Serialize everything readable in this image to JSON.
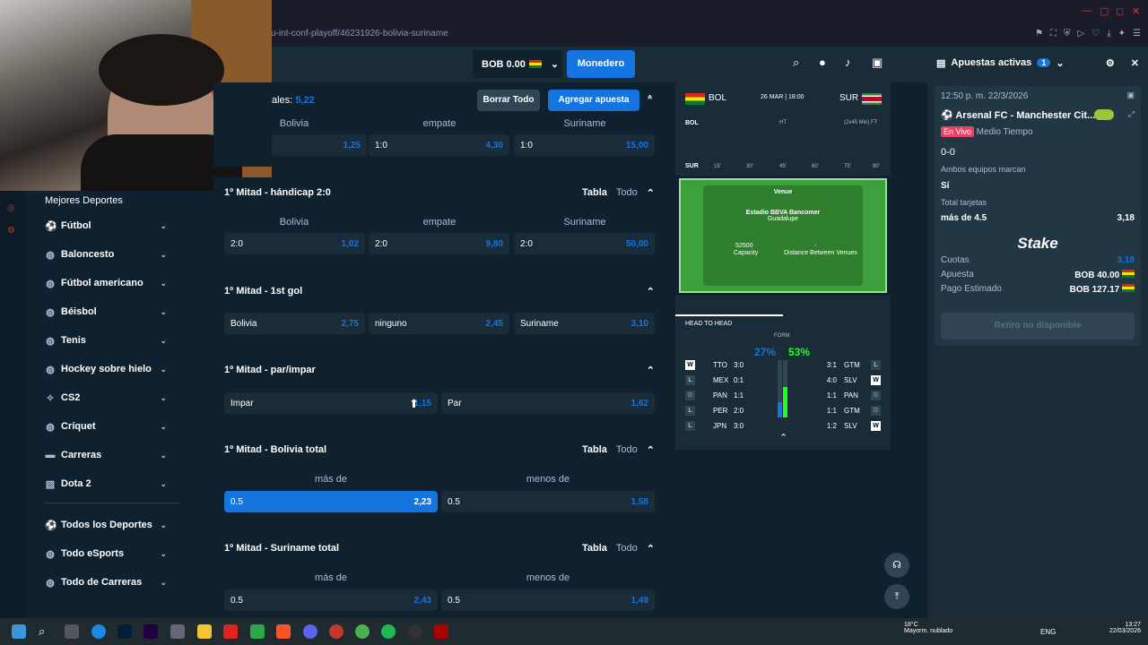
{
  "browser": {
    "url": "u-int-conf-playoff/46231926-bolivia-suriname"
  },
  "header": {
    "balance": "BOB 0.00",
    "wallet_label": "Monedero"
  },
  "sidebar": {
    "title": "Mejores Deportes",
    "items": [
      "Fútbol",
      "Baloncesto",
      "Fútbol americano",
      "Béisbol",
      "Tenis",
      "Hockey sobre hielo",
      "CS2",
      "Críquet",
      "Carreras",
      "Dota 2"
    ],
    "more": [
      "Todos los Deportes",
      "Todo eSports",
      "Todo de Carreras"
    ]
  },
  "toolbar": {
    "partial_label": "ales:",
    "partial_value": "5,22",
    "clear": "Borrar Todo",
    "add": "Agregar apuesta"
  },
  "common": {
    "tabla": "Tabla",
    "todo": "Todo",
    "mas": "más de",
    "menos": "menos de"
  },
  "sec0": {
    "cols": [
      "Bolivia",
      "empate",
      "Suriname"
    ],
    "odds": [
      {
        "l": "",
        "v": "1,25"
      },
      {
        "l": "1:0",
        "v": "4,30"
      },
      {
        "l": "1:0",
        "v": "15,00"
      }
    ]
  },
  "sec1": {
    "title": "1º Mitad - hándicap 2:0",
    "cols": [
      "Bolivia",
      "empate",
      "Suriname"
    ],
    "odds": [
      {
        "l": "2:0",
        "v": "1,02"
      },
      {
        "l": "2:0",
        "v": "9,80"
      },
      {
        "l": "2:0",
        "v": "50,00"
      }
    ]
  },
  "sec2": {
    "title": "1º Mitad - 1st gol",
    "odds": [
      {
        "l": "Bolivia",
        "v": "2,75"
      },
      {
        "l": "ninguno",
        "v": "2,45"
      },
      {
        "l": "Suriname",
        "v": "3,10"
      }
    ]
  },
  "sec3": {
    "title": "1º Mitad - par/impar",
    "odds": [
      {
        "l": "Impar",
        "v": "1,15"
      },
      {
        "l": "Par",
        "v": "1,62"
      }
    ]
  },
  "sec4": {
    "title": "1º Mitad - Bolivia total",
    "odds": [
      {
        "l": "0.5",
        "v": "2,23"
      },
      {
        "l": "0.5",
        "v": "1,58"
      }
    ]
  },
  "sec5": {
    "title": "1º Mitad - Suriname total",
    "odds": [
      {
        "l": "0.5",
        "v": "2,43"
      },
      {
        "l": "0.5",
        "v": "1,49"
      }
    ]
  },
  "tracker": {
    "home": "BOL",
    "away": "SUR",
    "date": "26 MAR | 18:00",
    "ht": "HT",
    "ft": "(2x45 Min) FT",
    "minutes": [
      "15'",
      "30'",
      "45'",
      "60'",
      "75'",
      "90'"
    ],
    "venue_label": "Venue",
    "venue": "Estadio BBVA Bancomer",
    "city": "Guadalupe",
    "capacity": "52500",
    "capacity_label": "Capacity",
    "distance": "-",
    "distance_label": "Distance Between Venues",
    "h2h": "HEAD TO HEAD",
    "form": "FORM",
    "home_pct": "27%",
    "away_pct": "53%",
    "home_rows": [
      {
        "r": "W",
        "t": "TTO",
        "s": "3:0"
      },
      {
        "r": "L",
        "t": "MEX",
        "s": "0:1"
      },
      {
        "r": "D",
        "t": "PAN",
        "s": "1:1"
      },
      {
        "r": "L",
        "t": "PER",
        "s": "2:0"
      },
      {
        "r": "L",
        "t": "JPN",
        "s": "3:0"
      }
    ],
    "away_rows": [
      {
        "r": "L",
        "t": "GTM",
        "s": "3:1"
      },
      {
        "r": "W",
        "t": "SLV",
        "s": "4:0"
      },
      {
        "r": "D",
        "t": "PAN",
        "s": "1:1"
      },
      {
        "r": "D",
        "t": "GTM",
        "s": "1:1"
      },
      {
        "r": "W",
        "t": "SLV",
        "s": "1:2"
      }
    ]
  },
  "betslip": {
    "title": "Apuestas activas",
    "count": "1",
    "time": "12:50 p. m. 22/3/2026",
    "match": "Arsenal FC - Manchester Cit...",
    "live": "En Vivo",
    "period": "Medio Tiempo",
    "score": "0-0",
    "market1": "Ambos equipos marcan",
    "sel1": "Sí",
    "market2": "Total tarjetas",
    "sel2": "más de 4.5",
    "sel2_odd": "3,18",
    "brand": "Stake",
    "cuotas": "Cuotas",
    "cuotas_v": "3,18",
    "apuesta": "Apuesta",
    "apuesta_v": "BOB 40.00",
    "pago": "Pago Estimado",
    "pago_v": "BOB 127.17",
    "cashout": "Retiro no disponible"
  },
  "taskbar": {
    "weather_temp": "18°C",
    "weather": "Mayorm. nublado",
    "lang": "ENG",
    "time": "13:27",
    "date": "22/03/2026"
  }
}
